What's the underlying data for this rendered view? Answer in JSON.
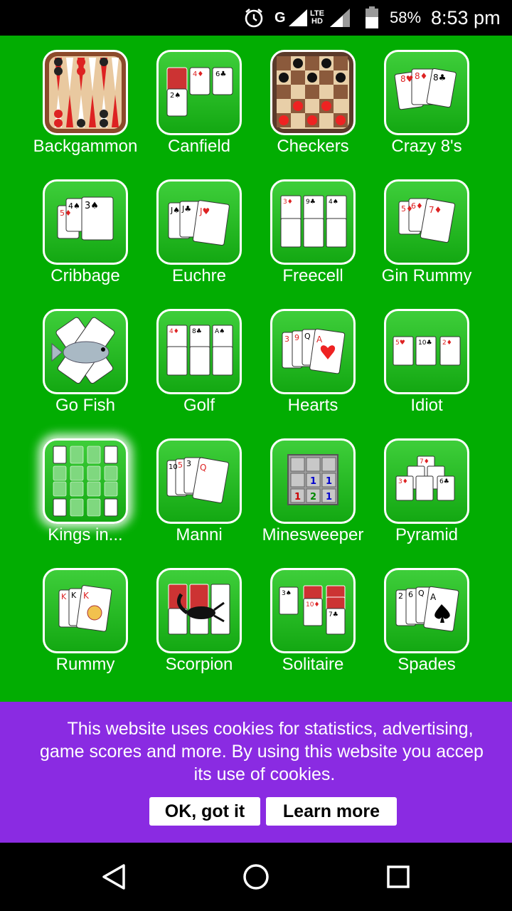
{
  "status_bar": {
    "network": "G",
    "lte": "LTE",
    "hd": "HD",
    "battery": "58%",
    "time": "8:53 pm",
    "icons": [
      "alarm-icon",
      "signal-icon",
      "battery-icon"
    ]
  },
  "apps": [
    {
      "label": "Backgammon",
      "icon": "backgammon-icon"
    },
    {
      "label": "Canfield",
      "icon": "canfield-icon"
    },
    {
      "label": "Checkers",
      "icon": "checkers-icon"
    },
    {
      "label": "Crazy 8's",
      "icon": "crazy-eights-icon"
    },
    {
      "label": "Cribbage",
      "icon": "cribbage-icon"
    },
    {
      "label": "Euchre",
      "icon": "euchre-icon"
    },
    {
      "label": "Freecell",
      "icon": "freecell-icon"
    },
    {
      "label": "Gin Rummy",
      "icon": "gin-rummy-icon"
    },
    {
      "label": "Go Fish",
      "icon": "go-fish-icon"
    },
    {
      "label": "Golf",
      "icon": "golf-icon"
    },
    {
      "label": "Hearts",
      "icon": "hearts-icon"
    },
    {
      "label": "Idiot",
      "icon": "idiot-icon"
    },
    {
      "label": "Kings in...",
      "icon": "kings-in-the-corner-icon"
    },
    {
      "label": "Manni",
      "icon": "manni-icon"
    },
    {
      "label": "Minesweeper",
      "icon": "minesweeper-icon"
    },
    {
      "label": "Pyramid",
      "icon": "pyramid-icon"
    },
    {
      "label": "Rummy",
      "icon": "rummy-icon"
    },
    {
      "label": "Scorpion",
      "icon": "scorpion-icon"
    },
    {
      "label": "Solitaire",
      "icon": "solitaire-icon"
    },
    {
      "label": "Spades",
      "icon": "spades-icon"
    }
  ],
  "cookie_banner": {
    "line1": "This website uses cookies for statistics, advertising,",
    "line2": "game scores and more. By using this website you accep",
    "line3": "its use of cookies.",
    "ok_label": "OK, got it",
    "learn_label": "Learn more"
  },
  "colors": {
    "background": "#02ad02",
    "banner": "#8a2be2"
  },
  "nav": {
    "icons": [
      "back-icon",
      "home-icon",
      "recent-apps-icon"
    ]
  }
}
